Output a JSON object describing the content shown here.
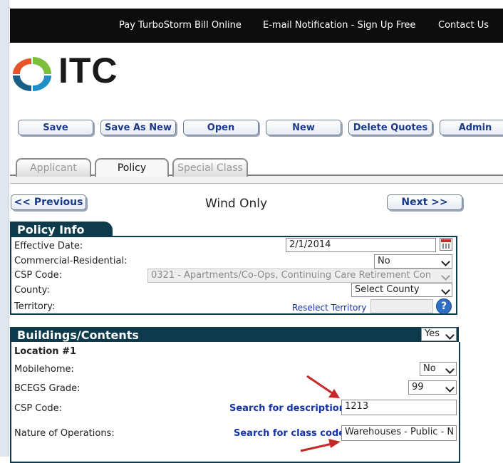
{
  "topnav": {
    "pay_bill": "Pay TurboStorm Bill Online",
    "email_notification": "E-mail Notification - Sign Up Free",
    "contact_us": "Contact Us"
  },
  "logo": {
    "text": "ITC"
  },
  "toolbar": {
    "save": "Save",
    "save_as_new": "Save As New",
    "open": "Open",
    "new": "New",
    "delete_quotes": "Delete Quotes",
    "admin": "Admin"
  },
  "tabs": [
    {
      "label": "Applicant",
      "state": "inactive"
    },
    {
      "label": "Policy",
      "state": "active"
    },
    {
      "label": "Special Class",
      "state": "inactive"
    }
  ],
  "nav": {
    "previous": "<< Previous",
    "next": "Next >>",
    "page_title": "Wind Only"
  },
  "policy_info": {
    "heading": "Policy Info",
    "effective_date": {
      "label": "Effective Date:",
      "value": "2/1/2014"
    },
    "commercial_residential": {
      "label": "Commercial-Residential:",
      "value": "No"
    },
    "csp_code": {
      "label": "CSP Code:",
      "value": "0321 - Apartments/Co-Ops, Continuing Care Retirement Con"
    },
    "county": {
      "label": "County:",
      "value": "Select County"
    },
    "territory": {
      "label": "Territory:",
      "link": "Reselect Territory",
      "value": ""
    }
  },
  "buildings_contents": {
    "heading": "Buildings/Contents",
    "selected": "Yes",
    "location_title": "Location #1",
    "mobilehome": {
      "label": "Mobilehome:",
      "value": "No"
    },
    "bcegs_grade": {
      "label": "BCEGS Grade:",
      "value": "99"
    },
    "csp_code": {
      "label": "CSP Code:",
      "link": "Search for description",
      "value": "1213"
    },
    "nature_of_operations": {
      "label": "Nature of Operations:",
      "link": "Search for class code",
      "value": "Warehouses - Public - N"
    }
  },
  "colors": {
    "topbar": "#0d0d0d",
    "section_header": "#0d3b4b",
    "button_text": "#1a3a8a",
    "link": "#1533a8",
    "annotation_arrow": "#c62828"
  }
}
